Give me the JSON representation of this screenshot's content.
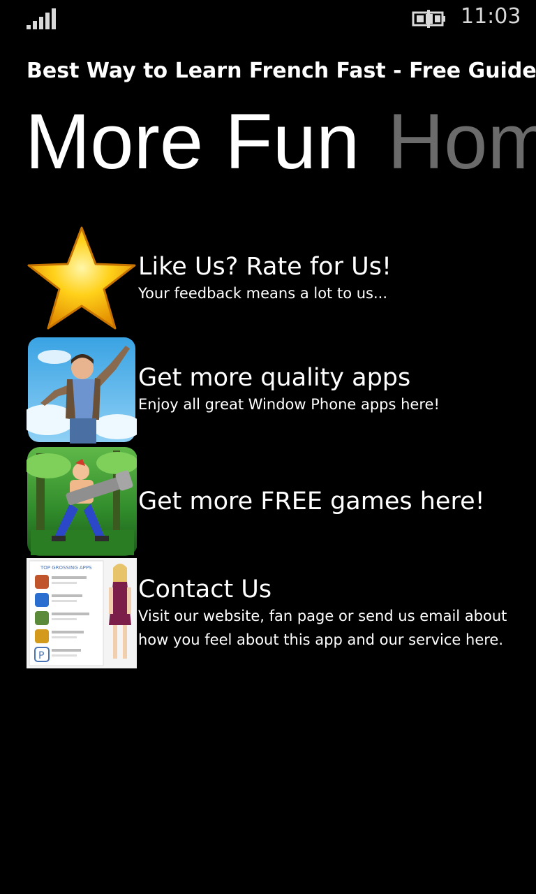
{
  "status_bar": {
    "time": "11:03",
    "signal_icon": "signal-strength-icon",
    "battery_icon": "battery-charging-icon"
  },
  "app": {
    "title": "Best Way to Learn French Fast - Free Guide L"
  },
  "pivot": {
    "active": "More Fun",
    "inactive": "Home"
  },
  "items": [
    {
      "title": "Like Us? Rate for Us!",
      "subtitle": "Your feedback means a lot to us...",
      "icon": "star-icon"
    },
    {
      "title": "Get more quality apps",
      "subtitle": "Enjoy all great Window Phone apps here!",
      "icon": "jumping-man-image"
    },
    {
      "title": "Get more FREE games here!",
      "subtitle": "",
      "icon": "game-character-image"
    },
    {
      "title": "Contact Us",
      "subtitle": "Visit our website, fan page or send us email about how you feel about this app and our service here.",
      "icon": "top-grossing-apps-image",
      "thumb_heading": "TOP GROSSING APPS"
    }
  ],
  "colors": {
    "background": "#000000",
    "text": "#ffffff",
    "inactive_pivot": "#6b6b6b",
    "star": "#f7b500"
  }
}
